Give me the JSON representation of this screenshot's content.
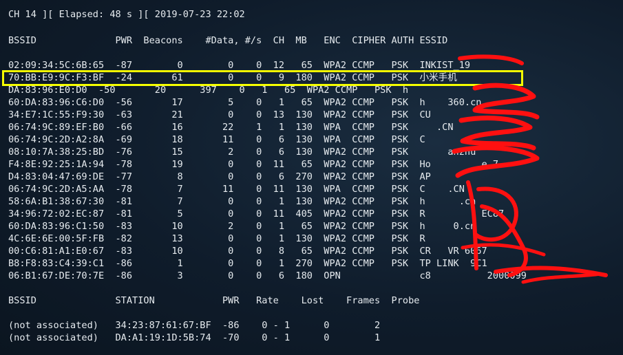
{
  "status_line": "CH 14 ][ Elapsed: 48 s ][ 2019-07-23 22:02",
  "ap_header": "BSSID              PWR  Beacons    #Data, #/s  CH  MB   ENC  CIPHER AUTH ESSID",
  "ap_rows": [
    "02:09:34:5C:6B:65  -87        0        0    0  12   65  WPA2 CCMP   PSK  INKIST_19",
    "70:BB:E9:9C:F3:BF  -24       61        0    0   9  180  WPA2 CCMP   PSK  小米手机",
    "DA:83:96:E0:D0  -50       20      397    0   1   65  WPA2 CCMP   PSK  h",
    "60:DA:83:96:C6:D0  -56       17        5    0   1   65  WPA2 CCMP   PSK  h    360.cn",
    "34:E7:1C:55:F9:30  -63       21        0    0  13  130  WPA2 CCMP   PSK  CU",
    "06:74:9C:89:EF:B0  -66       16       22    1   1  130  WPA  CCMP   PSK     .CN",
    "06:74:9C:2D:A2:8A  -69       18       11    0   6  130  WPA  CCMP   PSK  C",
    "08:10:7A:38:25:BD  -76       15        2    0   6  130  WPA2 CCMP   PSK       anzhu",
    "F4:8E:92:25:1A:94  -78       19        0    0  11   65  WPA2 CCMP   PSK  Ho         e 7",
    "D4:83:04:47:69:DE  -77        8        0    0   6  270  WPA2 CCMP   PSK  AP",
    "06:74:9C:2D:A5:AA  -78        7       11    0  11  130  WPA  CCMP   PSK  C    .CN",
    "58:6A:B1:38:67:30  -81        7        0    0   1  130  WPA2 CCMP   PSK  h      .cn",
    "34:96:72:02:EC:87  -81        5        0    0  11  405  WPA2 CCMP   PSK  R          EC87",
    "60:DA:83:96:C1:50  -83       10        2    0   1   65  WPA2 CCMP   PSK  h     0.cn",
    "4C:6E:6E:00:5F:FB  -82       13        0    0   1  130  WPA2 CCMP   PSK  R",
    "00:C6:81:A1:E0:67  -83       10        0    0   8   65  WPA2 CCMP   PSK  CR   VR 6067",
    "B8:F8:83:C4:39:C1  -86        1        0    0   1  270  WPA2 CCMP   PSK  TP LINK  9C1",
    "06:B1:67:DE:70:7E  -86        3        0    0   6  180  OPN              c8          2000099"
  ],
  "station_header": "BSSID              STATION            PWR   Rate    Lost    Frames  Probe",
  "station_rows": [
    "(not associated)   34:23:87:61:67:BF  -86    0 - 1      0        2",
    "(not associated)   DA:A1:19:1D:5B:74  -70    0 - 1      0        1"
  ],
  "colors": {
    "background": "#0f1c2b",
    "text": "#e6ebef",
    "highlight": "#f6ff00",
    "redaction": "#ff1010"
  }
}
